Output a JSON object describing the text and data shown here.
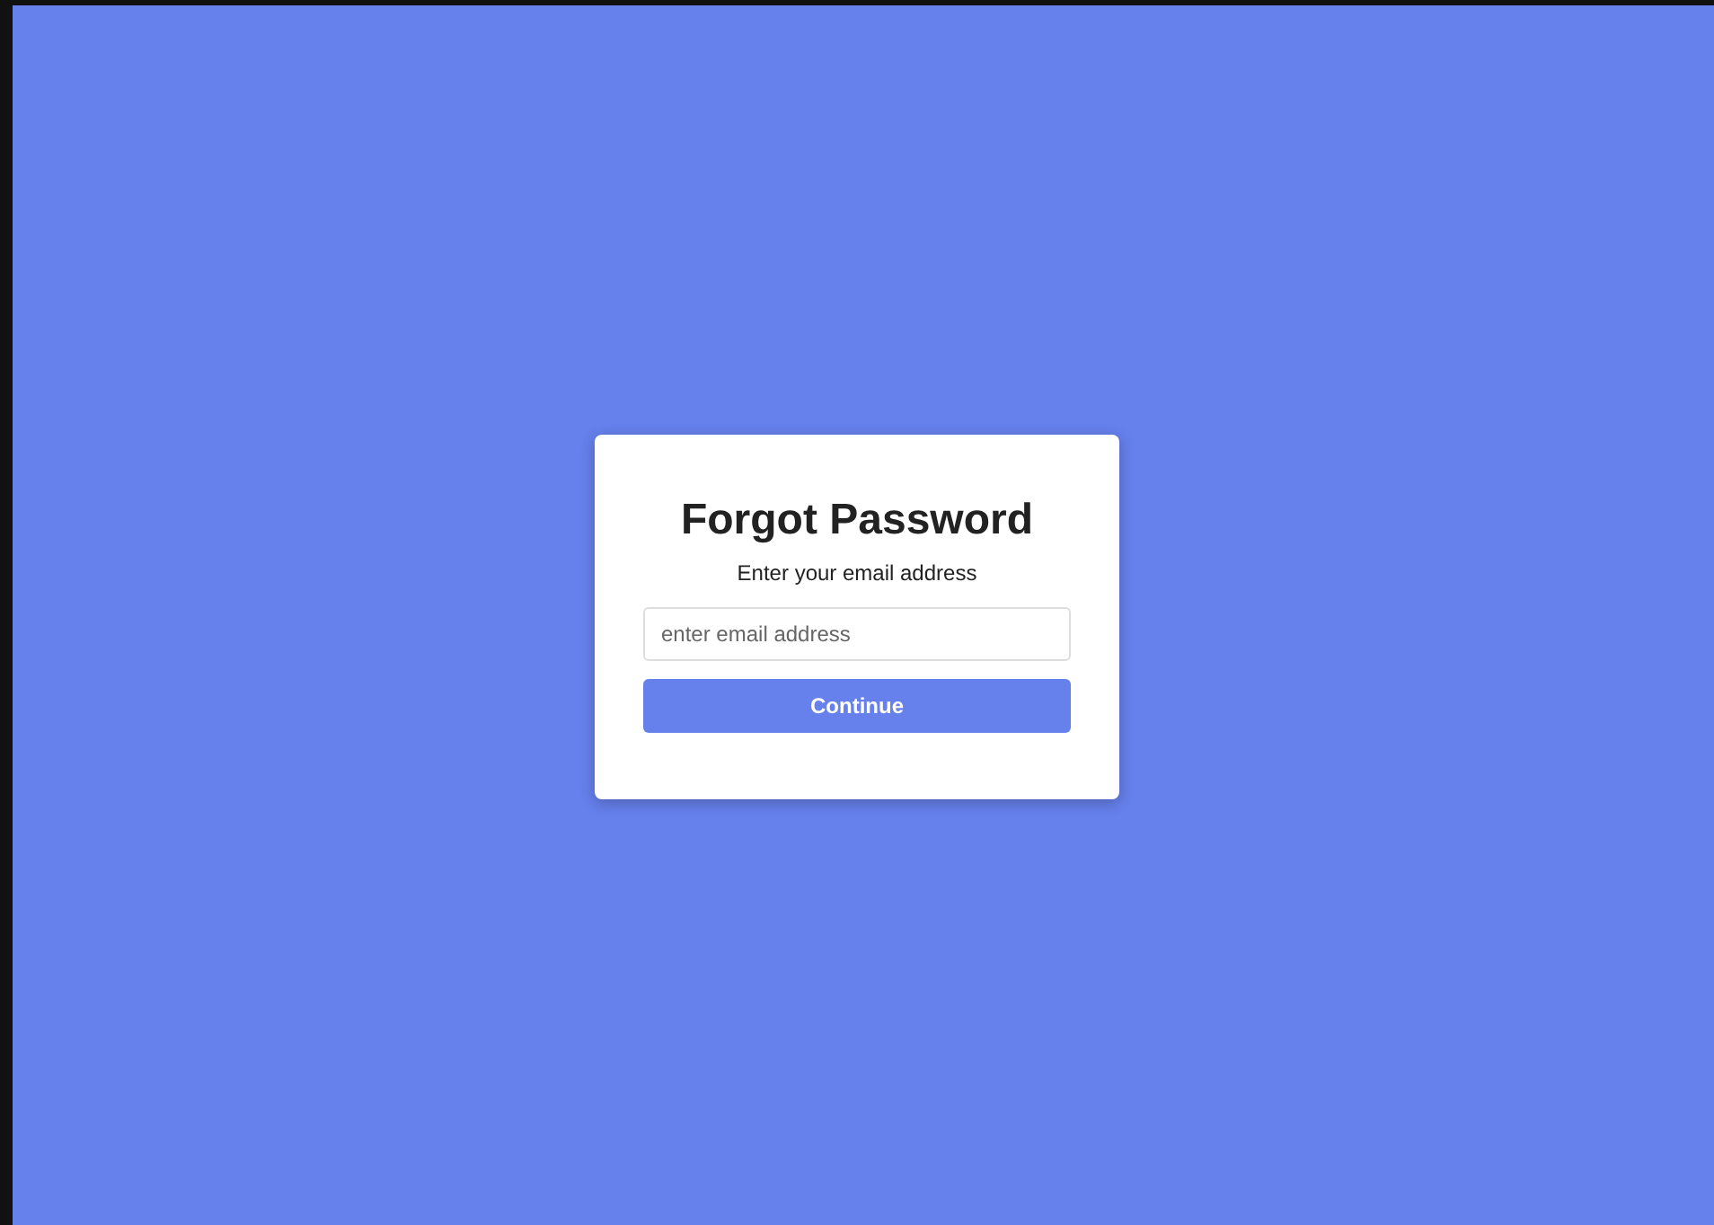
{
  "card": {
    "title": "Forgot Password",
    "subtitle": "Enter your email address",
    "email_field": {
      "placeholder": "enter email address"
    },
    "button": "Continue"
  }
}
